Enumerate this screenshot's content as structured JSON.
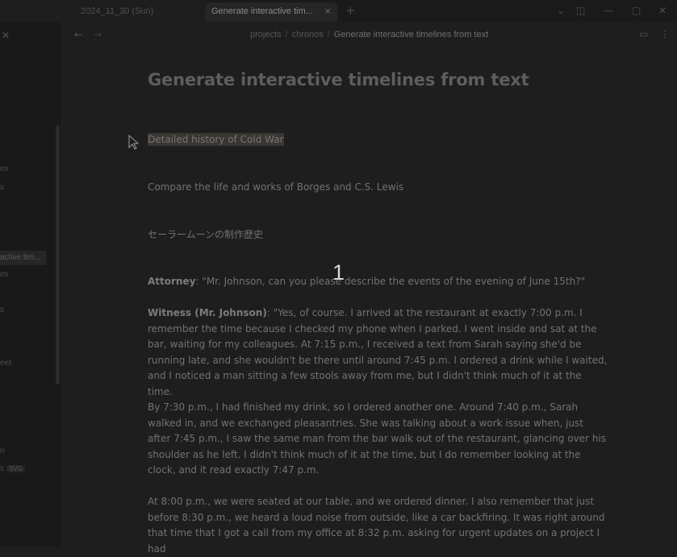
{
  "titlebar": {
    "tabs": [
      {
        "label": "2024_11_30 (Sun)",
        "active": false
      },
      {
        "label": "Generate interactive tim...",
        "active": true
      }
    ],
    "new_tab": "+",
    "close_tab": "×",
    "controls": {
      "dropdown": "⌄",
      "sidebar_toggle": "◫",
      "minimize": "—",
      "maximize": "▢",
      "close": "✕"
    }
  },
  "sidebar": {
    "collapse_icon": "✕",
    "items": [
      "es",
      "x",
      "active tim...",
      "es",
      "s",
      "eet",
      "n",
      "s"
    ],
    "badge": "SVG"
  },
  "header": {
    "back": "←",
    "forward": "→",
    "breadcrumb": [
      "projects",
      "chronos",
      "Generate interactive timelines from text"
    ],
    "separator": "/",
    "reading_icon": "▭",
    "more_icon": "⋮"
  },
  "doc": {
    "title": "Generate interactive timelines from text",
    "lines": [
      "Detailed history of Cold War",
      "Compare the life and works of Borges and C.S. Lewis",
      "セーラームーンの制作歴史"
    ],
    "attorney_label": "Attorney",
    "attorney_text": ": \"Mr. Johnson, can you please describe the events of the evening of June 15th?\"",
    "witness_label": "Witness (Mr. Johnson)",
    "witness_text": ": \"Yes, of course. I arrived at the restaurant at exactly 7:00 p.m. I remember the time because I checked my phone when I parked. I went inside and sat at the bar, waiting for my colleagues. At 7:15 p.m., I received a text from Sarah saying she'd be running late, and she wouldn't be there until around 7:45 p.m. I ordered a drink while I waited, and I noticed a man sitting a few stools away from me, but I didn't think much of it at the time.",
    "para2": "By 7:30 p.m., I had finished my drink, so I ordered another one. Around 7:40 p.m., Sarah walked in, and we exchanged pleasantries. She was talking about a work issue when, just after 7:45 p.m., I saw the same man from the bar walk out of the restaurant, glancing over his shoulder as he left. I didn't think much of it at the time, but I do remember looking at the clock, and it read exactly 7:47 p.m.",
    "para3": "At 8:00 p.m., we were seated at our table, and we ordered dinner. I also remember that just before 8:30 p.m., we heard a loud noise from outside, like a car backfiring. It was right around that time that I got a call from my office at 8:32 p.m. asking for urgent updates on a project I had"
  },
  "overlay_number": "1"
}
